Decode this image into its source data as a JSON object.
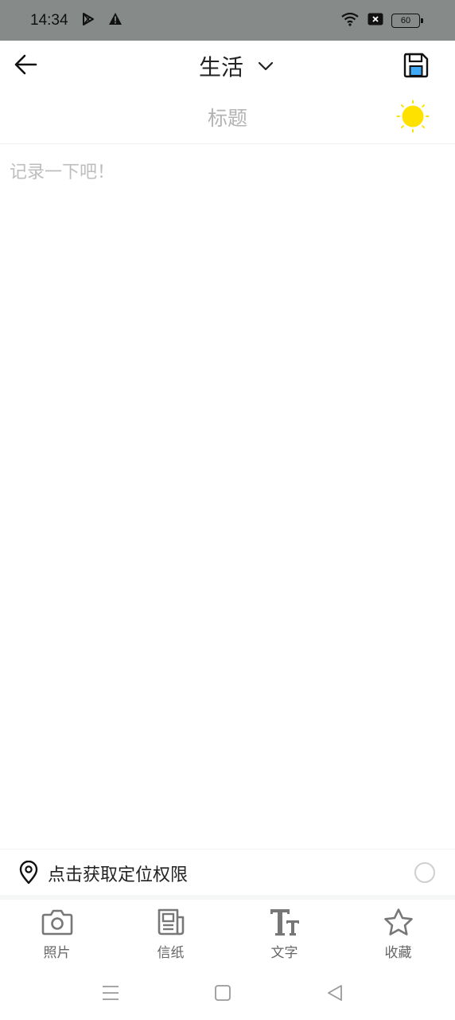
{
  "status_bar": {
    "time": "14:34",
    "battery": "60",
    "icons": [
      "play-store-icon",
      "warning-icon",
      "wifi-icon",
      "sim-icon",
      "battery-icon"
    ]
  },
  "app_bar": {
    "category": "生活",
    "icons": {
      "back": "arrow-left-icon",
      "dropdown": "chevron-down-icon",
      "save": "floppy-disk-icon"
    },
    "accent_color": "#3fa9f5"
  },
  "title_row": {
    "placeholder": "标题",
    "value": "",
    "weather_icon": "sun-icon",
    "weather_color": "#ffe100"
  },
  "editor": {
    "placeholder": "记录一下吧！",
    "value": ""
  },
  "location": {
    "label": "点击获取定位权限",
    "icon": "map-pin-icon",
    "enabled": false
  },
  "toolbar": {
    "items": [
      {
        "label": "照片",
        "icon": "camera-icon"
      },
      {
        "label": "信纸",
        "icon": "newspaper-icon"
      },
      {
        "label": "文字",
        "icon": "text-format-icon"
      },
      {
        "label": "收藏",
        "icon": "star-icon"
      }
    ]
  },
  "system_nav": {
    "icons": [
      "menu-icon",
      "home-icon",
      "back-triangle-icon"
    ]
  }
}
